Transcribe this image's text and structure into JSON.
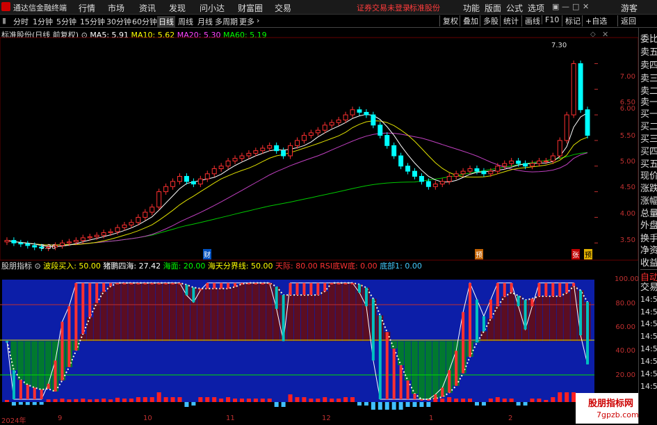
{
  "menubar": {
    "app_title": "通达信金融终端",
    "items": [
      "行情",
      "市场",
      "资讯",
      "发现",
      "问小达",
      "财富圈",
      "交易"
    ],
    "status": "证券交易未登录",
    "stock_label": "标准股份",
    "right_items": [
      "功能",
      "版面",
      "公式",
      "选项"
    ],
    "guest": "游客"
  },
  "periodbar": {
    "periods": [
      "分时",
      "1分钟",
      "5分钟",
      "15分钟",
      "30分钟",
      "60分钟",
      "日线",
      "周线",
      "月线",
      "多周期",
      "更多"
    ],
    "active": "日线",
    "tools": [
      "复权",
      "叠加",
      "多股",
      "统计",
      "画线",
      "F10",
      "标记",
      "+自选",
      "返回"
    ]
  },
  "main_header": {
    "name": "标准股份(日线 前复权)",
    "ma5_label": "MA5: 5.91",
    "ma10_label": "MA10: 5.62",
    "ma20_label": "MA20: 5.30",
    "ma60_label": "MA60: 5.19",
    "colors": {
      "ma5": "#ffffff",
      "ma10": "#ffff00",
      "ma20": "#ff40ff",
      "ma60": "#00ff00"
    }
  },
  "main_axis": [
    "7.00",
    "6.50",
    "6.00",
    "5.50",
    "5.00",
    "4.50",
    "4.00",
    "3.50"
  ],
  "annotations": {
    "high": "7.30",
    "low": "3.36",
    "marker_cai": "财",
    "marker_yu": "预",
    "marker_zhang": "张",
    "marker_yu2": "预"
  },
  "sub_header": {
    "name": "股朋指标",
    "items": [
      {
        "text": "波段买入: 50.00",
        "color": "#ffff00"
      },
      {
        "text": "猪鹏四海: 27.42",
        "color": "#ffffff"
      },
      {
        "text": "海面: 20.00",
        "color": "#00ff00"
      },
      {
        "text": "海天分界线: 50.00",
        "color": "#ffff00"
      },
      {
        "text": "天际: 80.00",
        "color": "#ff3030"
      },
      {
        "text": "RSI底W底: 0.00",
        "color": "#ff3030"
      },
      {
        "text": "底部1: 0.00",
        "color": "#40c0ff"
      }
    ]
  },
  "sub_axis": [
    "100.00",
    "80.00",
    "60.00",
    "40.00",
    "20.00"
  ],
  "x_axis": [
    "2024年",
    "9",
    "10",
    "11",
    "12",
    "1",
    "2"
  ],
  "right_panel": {
    "items": [
      "委比",
      "卖五",
      "卖四",
      "卖三",
      "卖二",
      "卖一",
      "买一",
      "买二",
      "买三",
      "买四",
      "买五",
      "现价",
      "涨跌",
      "涨幅",
      "总量",
      "外盘",
      "换手",
      "净资",
      "收益"
    ],
    "auto": "自动",
    "trade": "交易",
    "times": [
      "14:56",
      "14:56",
      "14:56",
      "14:56",
      "14:56",
      "14:56",
      "14:56",
      "14:56"
    ]
  },
  "watermark": {
    "line1": "股朋指标网",
    "line2": "7gpzb.com"
  },
  "chart_data": {
    "type": "candlestick",
    "close": [
      3.55,
      3.5,
      3.48,
      3.45,
      3.42,
      3.4,
      3.42,
      3.45,
      3.5,
      3.52,
      3.55,
      3.6,
      3.62,
      3.65,
      3.7,
      3.72,
      3.8,
      3.85,
      3.9,
      4.0,
      4.1,
      4.2,
      4.5,
      4.6,
      4.7,
      4.8,
      4.7,
      4.65,
      4.75,
      4.85,
      4.95,
      5.0,
      5.1,
      5.15,
      5.2,
      5.25,
      5.3,
      5.35,
      5.4,
      5.3,
      5.2,
      5.4,
      5.5,
      5.6,
      5.65,
      5.7,
      5.8,
      5.85,
      5.9,
      6.0,
      6.1,
      6.05,
      6.0,
      5.8,
      5.6,
      5.4,
      5.2,
      5.0,
      4.9,
      4.8,
      4.7,
      4.6,
      4.65,
      4.7,
      4.8,
      4.85,
      4.9,
      4.95,
      4.9,
      4.85,
      4.9,
      5.0,
      5.05,
      5.1,
      5.05,
      5.0,
      5.05,
      5.1,
      5.1,
      5.2,
      5.5,
      6.0,
      7.0,
      6.1,
      5.6
    ],
    "ylim": [
      3.3,
      7.4
    ],
    "ma5": 5.91,
    "ma10": 5.62,
    "ma20": 5.3,
    "ma60": 5.19
  }
}
